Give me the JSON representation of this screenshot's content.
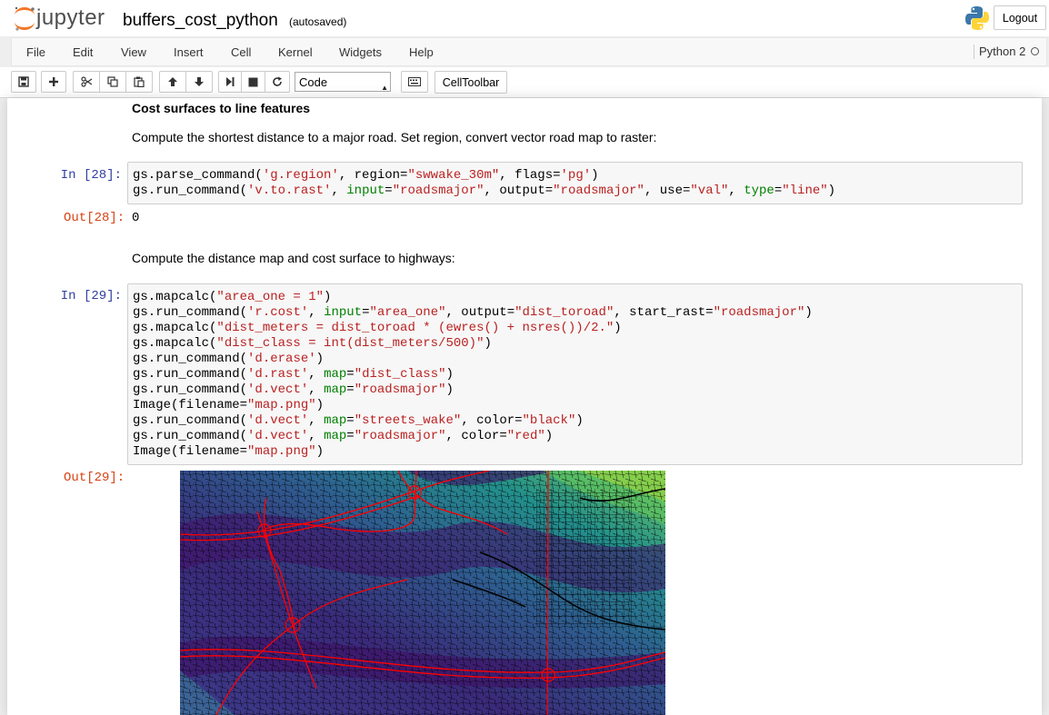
{
  "header": {
    "logo_text": "jupyter",
    "notebook_name": "buffers_cost_python",
    "autosave": "(autosaved)",
    "logout_label": "Logout"
  },
  "menubar": {
    "items": [
      "File",
      "Edit",
      "View",
      "Insert",
      "Cell",
      "Kernel",
      "Widgets",
      "Help"
    ],
    "kernel_name": "Python 2"
  },
  "toolbar": {
    "icons": [
      "save-icon",
      "plus-icon",
      "scissors-icon",
      "copy-icon",
      "paste-icon",
      "arrow-up-icon",
      "arrow-down-icon",
      "step-forward-icon",
      "stop-icon",
      "refresh-icon",
      "keyboard-icon"
    ],
    "cell_type": "Code",
    "celltoolbar_label": "CellToolbar"
  },
  "cells": {
    "md1_heading": "Cost surfaces to line features",
    "md1_text": "Compute the shortest distance to a major road. Set region, convert vector road map to raster:",
    "in28_prompt": "In [28]:",
    "code28": [
      "gs.parse_command('g.region', region=\"swwake_30m\", flags='pg')",
      "gs.run_command('v.to.rast', input=\"roadsmajor\", output=\"roadsmajor\", use=\"val\", type=\"line\")"
    ],
    "out28_prompt": "Out[28]:",
    "out28_value": "0",
    "md2_text": "Compute the distance map and cost surface to highways:",
    "in29_prompt": "In [29]:",
    "code29": [
      "gs.mapcalc(\"area_one = 1\")",
      "gs.run_command('r.cost', input=\"area_one\", output=\"dist_toroad\", start_rast=\"roadsmajor\")",
      "gs.mapcalc(\"dist_meters = dist_toroad * (ewres() + nsres())/2.\")",
      "gs.mapcalc(\"dist_class = int(dist_meters/500)\")",
      "gs.run_command('d.erase')",
      "gs.run_command('d.rast', map=\"dist_class\")",
      "gs.run_command('d.vect', map=\"roadsmajor\")",
      "Image(filename=\"map.png\")",
      "gs.run_command('d.vect', map=\"streets_wake\", color=\"black\")",
      "gs.run_command('d.vect', map=\"roadsmajor\", color=\"red\")",
      "Image(filename=\"map.png\")"
    ],
    "out29_prompt": "Out[29]:"
  },
  "colors": {
    "in_prompt": "#303f9f",
    "out_prompt": "#d84315",
    "string": "#ba2121",
    "keyword_arg": "#008000",
    "road_major": "#ff0000"
  }
}
